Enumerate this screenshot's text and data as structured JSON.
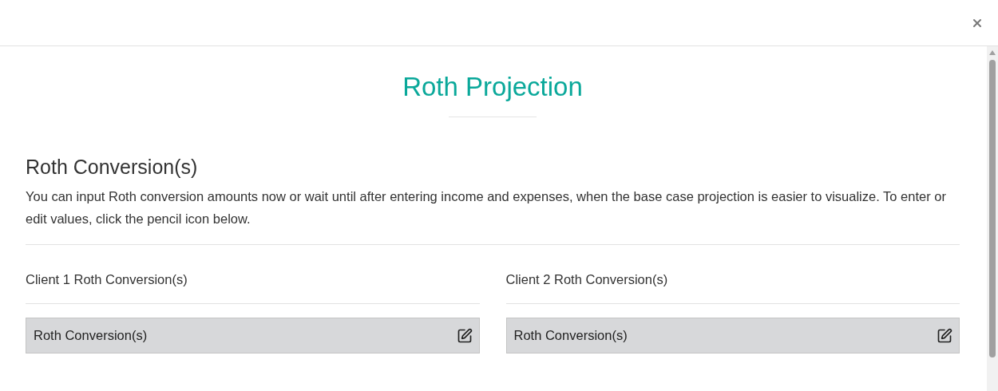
{
  "title": "Roth Projection",
  "section": {
    "heading": "Roth Conversion(s)",
    "description": "You can input Roth conversion amounts now or wait until after entering income and expenses, when the base case projection is easier to visualize. To enter or edit values, click the pencil icon below."
  },
  "clients": [
    {
      "label": "Client 1 Roth Conversion(s)",
      "row": "Roth Conversion(s)"
    },
    {
      "label": "Client 2 Roth Conversion(s)",
      "row": "Roth Conversion(s)"
    }
  ]
}
